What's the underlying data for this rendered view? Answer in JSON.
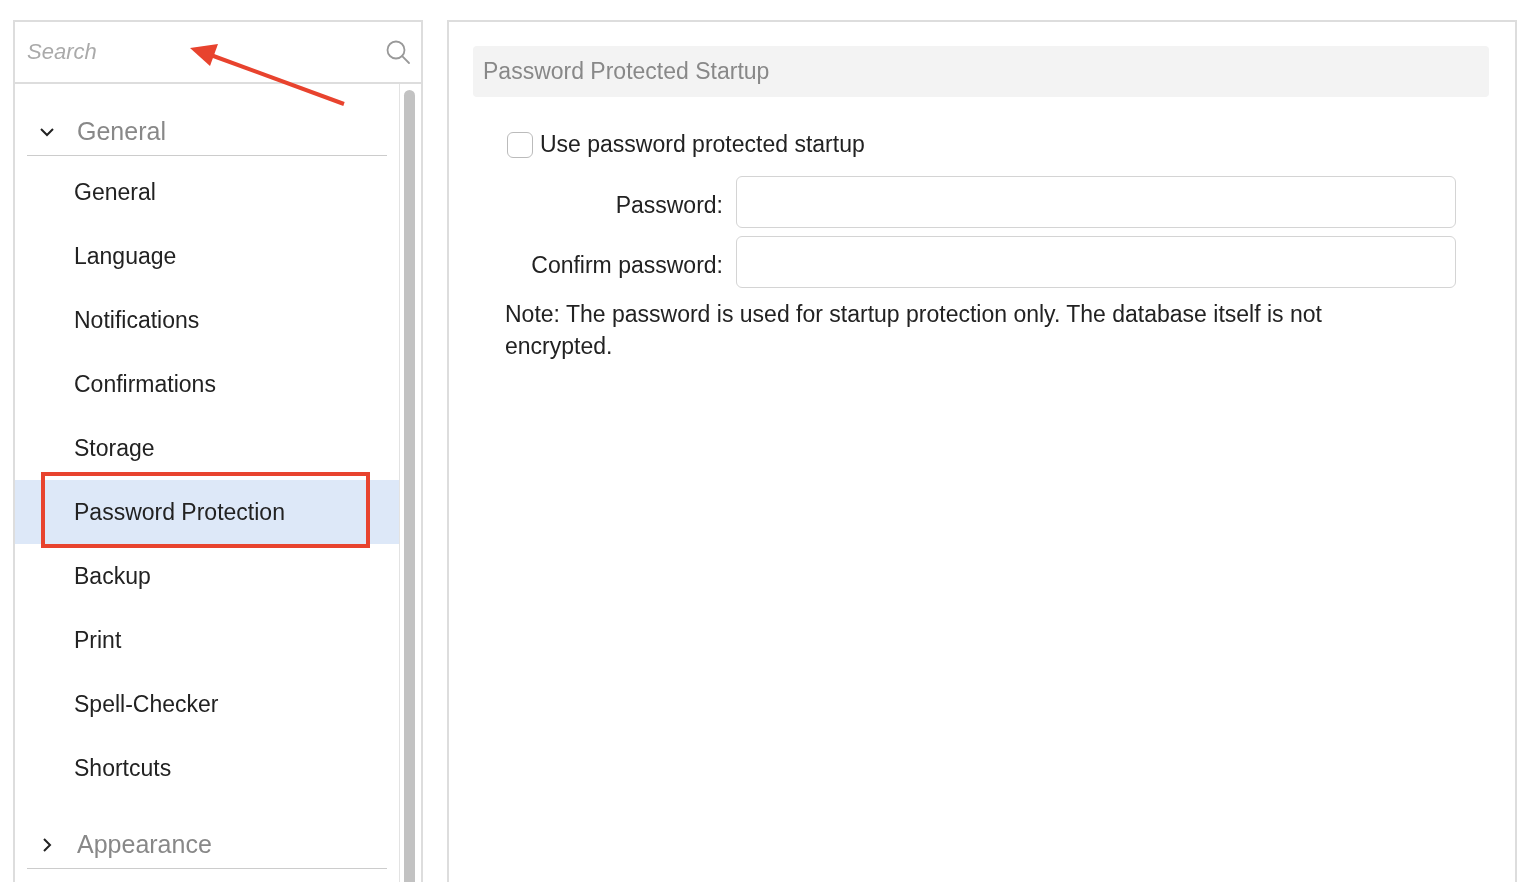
{
  "search": {
    "placeholder": "Search"
  },
  "tree": [
    {
      "label": "General",
      "expanded": true,
      "children": [
        {
          "label": "General",
          "selected": false
        },
        {
          "label": "Language",
          "selected": false
        },
        {
          "label": "Notifications",
          "selected": false
        },
        {
          "label": "Confirmations",
          "selected": false
        },
        {
          "label": "Storage",
          "selected": false
        },
        {
          "label": "Password Protection",
          "selected": true
        },
        {
          "label": "Backup",
          "selected": false
        },
        {
          "label": "Print",
          "selected": false
        },
        {
          "label": "Spell-Checker",
          "selected": false
        },
        {
          "label": "Shortcuts",
          "selected": false
        }
      ]
    },
    {
      "label": "Appearance",
      "expanded": false
    }
  ],
  "section": {
    "title": "Password Protected Startup"
  },
  "use_password": {
    "label": "Use password protected startup",
    "checked": false
  },
  "fields": [
    {
      "label": "Password:"
    },
    {
      "label": "Confirm password:"
    }
  ],
  "note": "Note: The password is used for startup protection only. The database itself is not encrypted."
}
